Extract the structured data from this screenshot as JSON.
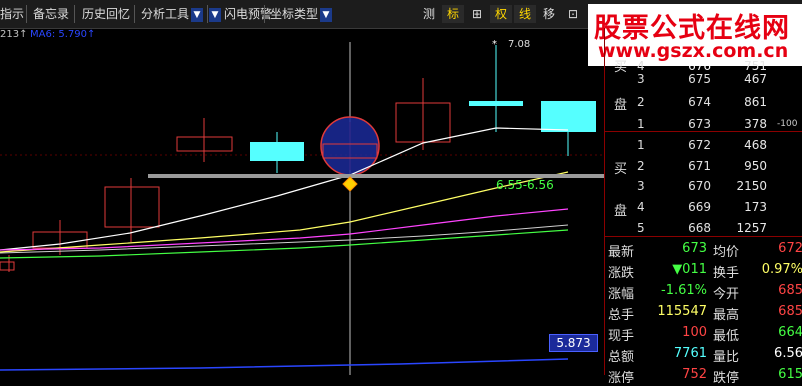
{
  "toolbar": {
    "items": [
      "指示",
      "备忘录",
      "历史回忆",
      "分析工具",
      "闪电预警",
      "坐标类型"
    ],
    "right_buttons": [
      "测",
      "标",
      "⊞",
      "权",
      "线",
      "移",
      "⊡"
    ]
  },
  "watermark": {
    "line1": "股票公式在线网",
    "line2": "www.gszx.com.cn"
  },
  "ma_labels": {
    "left": "213↑",
    "ma6": "MA6: 5.790↑"
  },
  "chart": {
    "high_label": "7.08",
    "range_label": "6.55-6.56",
    "value_box": "5.873",
    "colors": {
      "up": "#e03a3a",
      "down": "#55ffff",
      "ma1": "#ffffff",
      "ma2": "#ffff66",
      "ma3": "#ff44ff",
      "ma4": "#44ff44",
      "ref_line": "#9a9a9a"
    }
  },
  "order_book": {
    "sell_side_label": [
      "买",
      "盘"
    ],
    "buy_side_label": [
      "买",
      "盘"
    ],
    "sell": [
      {
        "idx": "4",
        "price": "676",
        "vol": "751"
      },
      {
        "idx": "3",
        "price": "675",
        "vol": "467"
      },
      {
        "idx": "2",
        "price": "674",
        "vol": "861"
      },
      {
        "idx": "1",
        "price": "673",
        "vol": "378",
        "change": "-100"
      }
    ],
    "buy": [
      {
        "idx": "1",
        "price": "672",
        "vol": "468"
      },
      {
        "idx": "2",
        "price": "671",
        "vol": "950"
      },
      {
        "idx": "3",
        "price": "670",
        "vol": "2150"
      },
      {
        "idx": "4",
        "price": "669",
        "vol": "173"
      },
      {
        "idx": "5",
        "price": "668",
        "vol": "1257"
      }
    ]
  },
  "quotes": [
    {
      "l": "最新",
      "lv": "673",
      "r": "均价",
      "rv": "672"
    },
    {
      "l": "涨跌",
      "lv": "▼011",
      "r": "换手",
      "rv": "0.97%"
    },
    {
      "l": "涨幅",
      "lv": "-1.61%",
      "r": "今开",
      "rv": "685"
    },
    {
      "l": "总手",
      "lv": "115547",
      "r": "最高",
      "rv": "685"
    },
    {
      "l": "现手",
      "lv": "100",
      "r": "最低",
      "rv": "664"
    },
    {
      "l": "总额",
      "lv": "7761",
      "r": "量比",
      "rv": "6.56"
    },
    {
      "l": "涨停",
      "lv": "752",
      "r": "跌停",
      "rv": "615"
    }
  ]
}
